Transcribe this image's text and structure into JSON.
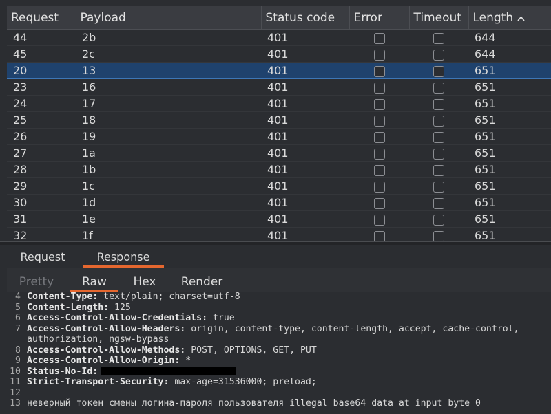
{
  "table": {
    "columns": [
      "Request",
      "Payload",
      "Status code",
      "Error",
      "Timeout",
      "Length"
    ],
    "sort_arrow": "^",
    "rows": [
      {
        "req": "44",
        "payload": "2b",
        "status": "401",
        "length": "644",
        "selected": false
      },
      {
        "req": "45",
        "payload": "2c",
        "status": "401",
        "length": "644",
        "selected": false
      },
      {
        "req": "20",
        "payload": "13",
        "status": "401",
        "length": "651",
        "selected": true
      },
      {
        "req": "23",
        "payload": "16",
        "status": "401",
        "length": "651",
        "selected": false
      },
      {
        "req": "24",
        "payload": "17",
        "status": "401",
        "length": "651",
        "selected": false
      },
      {
        "req": "25",
        "payload": "18",
        "status": "401",
        "length": "651",
        "selected": false
      },
      {
        "req": "26",
        "payload": "19",
        "status": "401",
        "length": "651",
        "selected": false
      },
      {
        "req": "27",
        "payload": "1a",
        "status": "401",
        "length": "651",
        "selected": false
      },
      {
        "req": "28",
        "payload": "1b",
        "status": "401",
        "length": "651",
        "selected": false
      },
      {
        "req": "29",
        "payload": "1c",
        "status": "401",
        "length": "651",
        "selected": false
      },
      {
        "req": "30",
        "payload": "1d",
        "status": "401",
        "length": "651",
        "selected": false
      },
      {
        "req": "31",
        "payload": "1e",
        "status": "401",
        "length": "651",
        "selected": false
      },
      {
        "req": "32",
        "payload": "1f",
        "status": "401",
        "length": "651",
        "selected": false
      }
    ]
  },
  "message_tabs": {
    "request": "Request",
    "response": "Response"
  },
  "view_tabs": {
    "pretty": "Pretty",
    "raw": "Raw",
    "hex": "Hex",
    "render": "Render"
  },
  "response_lines": [
    {
      "num": "4",
      "key": "Content-Type:",
      "value": " text/plain; charset=utf-8"
    },
    {
      "num": "5",
      "key": "Content-Length:",
      "value": " 125"
    },
    {
      "num": "6",
      "key": "Access-Control-Allow-Credentials:",
      "value": " true"
    },
    {
      "num": "7",
      "key": "Access-Control-Allow-Headers:",
      "value": " origin, content-type, content-length, accept, cache-control,"
    },
    {
      "num": "",
      "key": "",
      "value": "authorization, ngsw-bypass"
    },
    {
      "num": "8",
      "key": "Access-Control-Allow-Methods:",
      "value": " POST, OPTIONS, GET, PUT"
    },
    {
      "num": "9",
      "key": "Access-Control-Allow-Origin:",
      "value": " *"
    },
    {
      "num": "10",
      "key": "Status-No-Id:",
      "value": ""
    },
    {
      "num": "11",
      "key": "Strict-Transport-Security:",
      "value": " max-age=31536000; preload;"
    },
    {
      "num": "12",
      "key": "",
      "value": ""
    },
    {
      "num": "13",
      "key": "",
      "value": "неверный токен смены логина-пароля пользователя illegal base64 data at input byte 0"
    }
  ],
  "colors": {
    "accent": "#e5672f",
    "selection": "#1f426d"
  }
}
